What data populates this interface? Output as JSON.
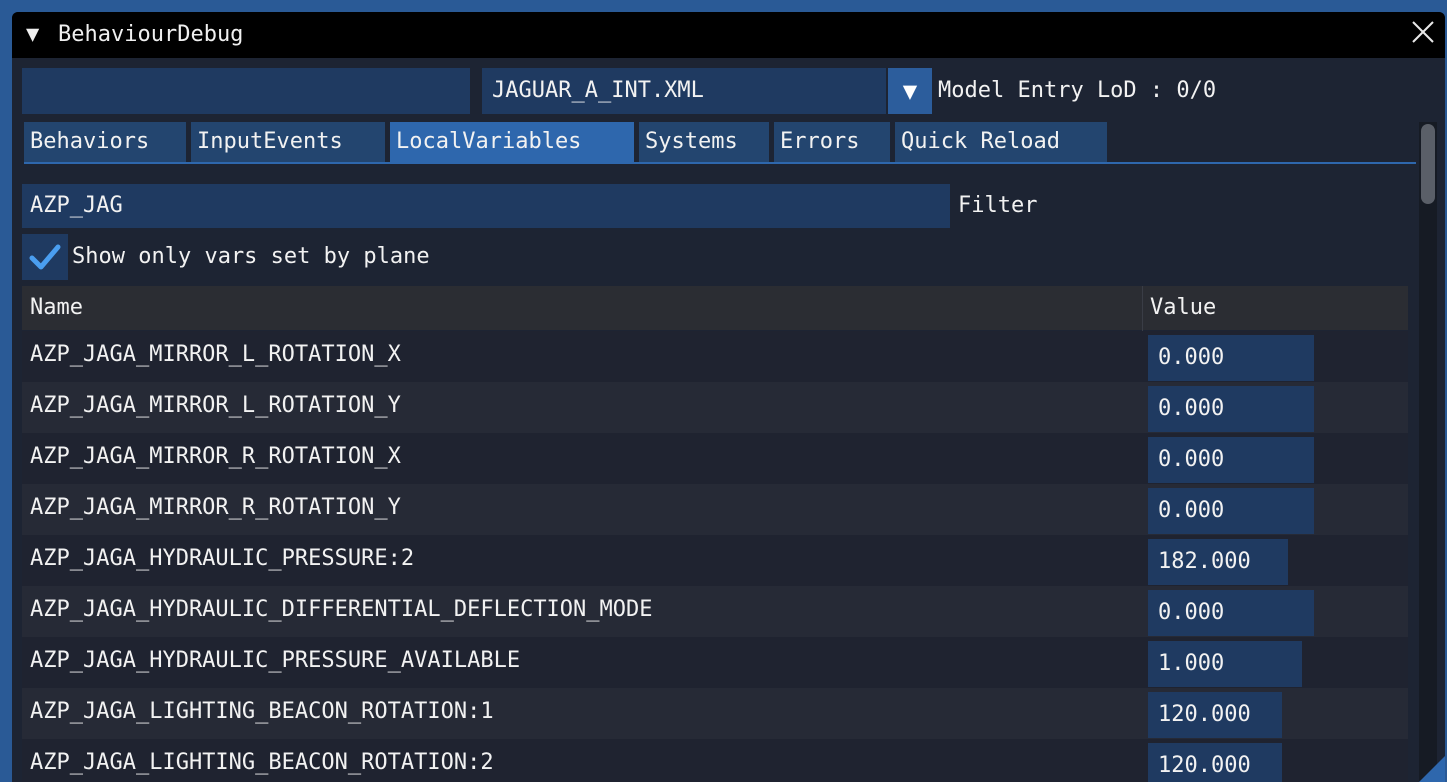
{
  "window": {
    "title": "BehaviourDebug",
    "collapse_glyph": "▼"
  },
  "toolbar": {
    "search_value": "",
    "file_select_value": "JAGUAR_A_INT.XML",
    "combo_glyph": "▼",
    "model_lod_label": "Model Entry LoD : 0/0"
  },
  "tabs": [
    {
      "label": "Behaviors",
      "active": false
    },
    {
      "label": "InputEvents",
      "active": false
    },
    {
      "label": "LocalVariables",
      "active": true
    },
    {
      "label": "Systems",
      "active": false
    },
    {
      "label": "Errors",
      "active": false
    },
    {
      "label": "Quick Reload",
      "active": false
    }
  ],
  "filter": {
    "value": "AZP_JAG",
    "label": "Filter"
  },
  "show_only_plane": {
    "checked": true,
    "label": "Show only vars set by plane"
  },
  "table": {
    "headers": {
      "name": "Name",
      "value": "Value"
    },
    "rows": [
      {
        "name": "AZP_JAGA_MIRROR_L_ROTATION_X",
        "value": "0.000"
      },
      {
        "name": "AZP_JAGA_MIRROR_L_ROTATION_Y",
        "value": "0.000"
      },
      {
        "name": "AZP_JAGA_MIRROR_R_ROTATION_X",
        "value": "0.000"
      },
      {
        "name": "AZP_JAGA_MIRROR_R_ROTATION_Y",
        "value": "0.000"
      },
      {
        "name": "AZP_JAGA_HYDRAULIC_PRESSURE:2",
        "value": "182.000"
      },
      {
        "name": "AZP_JAGA_HYDRAULIC_DIFFERENTIAL_DEFLECTION_MODE",
        "value": "0.000"
      },
      {
        "name": "AZP_JAGA_HYDRAULIC_PRESSURE_AVAILABLE",
        "value": "1.000"
      },
      {
        "name": "AZP_JAGA_LIGHTING_BEACON_ROTATION:1",
        "value": "120.000"
      },
      {
        "name": "AZP_JAGA_LIGHTING_BEACON_ROTATION:2",
        "value": "120.000"
      }
    ]
  },
  "colors": {
    "accent": "#2e67ad",
    "field_bg": "#1f3a61",
    "window_bg": "#1d2433",
    "checkmark": "#4a9ef0"
  },
  "icons": {
    "close": "close-icon",
    "check": "checkmark-icon",
    "collapse": "triangle-down-icon",
    "combo": "chevron-down-icon"
  }
}
